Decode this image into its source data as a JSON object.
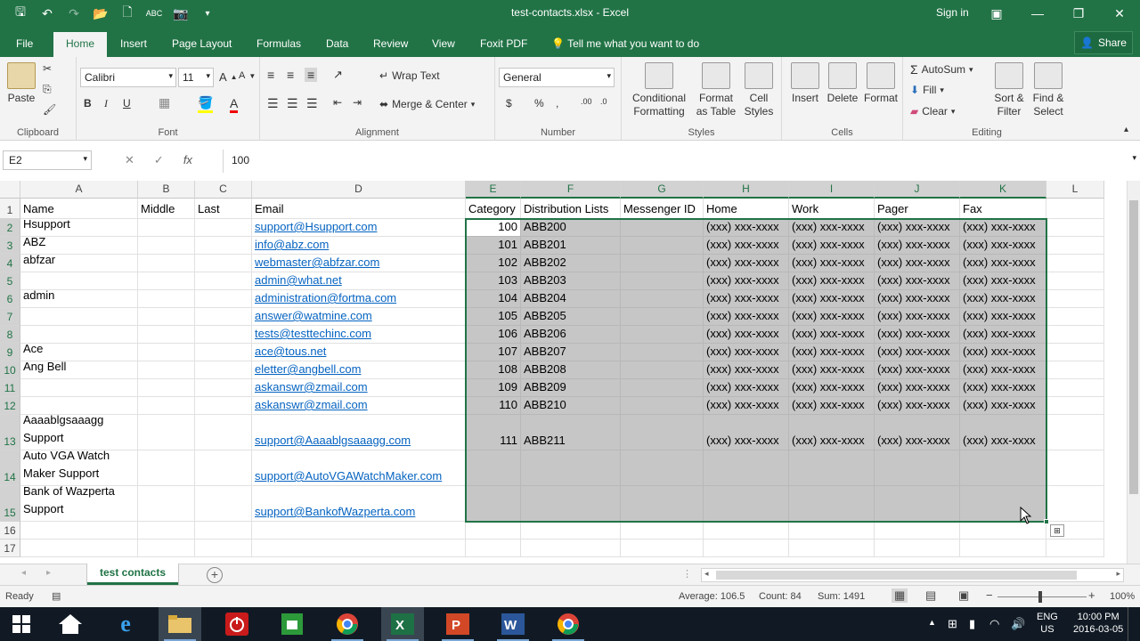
{
  "window": {
    "title": "test-contacts.xlsx - Excel",
    "sign_in": "Sign in"
  },
  "tabs": [
    "File",
    "Home",
    "Insert",
    "Page Layout",
    "Formulas",
    "Data",
    "Review",
    "View",
    "Foxit PDF"
  ],
  "tell_me": "Tell me what you want to do",
  "share": "Share",
  "ribbon": {
    "clipboard": {
      "paste": "Paste",
      "label": "Clipboard"
    },
    "font": {
      "name": "Calibri",
      "size": "11",
      "label": "Font"
    },
    "alignment": {
      "wrap_text": "Wrap Text",
      "merge_center": "Merge & Center",
      "label": "Alignment"
    },
    "number": {
      "format": "General",
      "label": "Number"
    },
    "styles": {
      "conditional": "Conditional Formatting",
      "format_table": "Format as Table",
      "cell_styles": "Cell Styles",
      "label": "Styles"
    },
    "cells": {
      "insert": "Insert",
      "delete": "Delete",
      "format": "Format",
      "label": "Cells"
    },
    "editing": {
      "autosum": "AutoSum",
      "fill": "Fill",
      "clear": "Clear",
      "sort": "Sort & Filter",
      "find": "Find & Select",
      "label": "Editing"
    }
  },
  "formula_bar": {
    "name_box": "E2",
    "fx": "fx",
    "value": "100"
  },
  "columns": [
    "A",
    "B",
    "C",
    "D",
    "E",
    "F",
    "G",
    "H",
    "I",
    "J",
    "K",
    "L"
  ],
  "rows": [
    "1",
    "2",
    "3",
    "4",
    "5",
    "6",
    "7",
    "8",
    "9",
    "10",
    "11",
    "12",
    "13",
    "14",
    "15",
    "16",
    "17"
  ],
  "headers": [
    "Name",
    "Middle",
    "Last",
    "Email",
    "Category",
    "Distribution Lists",
    "Messenger ID",
    "Home",
    "Work",
    "Pager",
    "Fax"
  ],
  "data_rows": [
    {
      "name": "Hsupport",
      "email": "support@Hsupport.com",
      "cat": "100",
      "dist": "ABB200",
      "phone": "(xxx) xxx-xxxx"
    },
    {
      "name": "ABZ",
      "email": "info@abz.com",
      "cat": "101",
      "dist": "ABB201",
      "phone": "(xxx) xxx-xxxx"
    },
    {
      "name": "abfzar",
      "email": "webmaster@abfzar.com",
      "cat": "102",
      "dist": "ABB202",
      "phone": "(xxx) xxx-xxxx"
    },
    {
      "name": "",
      "email": "admin@what.net",
      "cat": "103",
      "dist": "ABB203",
      "phone": "(xxx) xxx-xxxx"
    },
    {
      "name": "admin",
      "email": "administration@fortma.com",
      "cat": "104",
      "dist": "ABB204",
      "phone": "(xxx) xxx-xxxx"
    },
    {
      "name": "",
      "email": "answer@watmine.com",
      "cat": "105",
      "dist": "ABB205",
      "phone": "(xxx) xxx-xxxx"
    },
    {
      "name": "",
      "email": "tests@testtechinc.com",
      "cat": "106",
      "dist": "ABB206",
      "phone": "(xxx) xxx-xxxx"
    },
    {
      "name": "Ace",
      "email": "ace@tous.net",
      "cat": "107",
      "dist": "ABB207",
      "phone": "(xxx) xxx-xxxx"
    },
    {
      "name": "Ang Bell",
      "email": "eletter@angbell.com",
      "cat": "108",
      "dist": "ABB208",
      "phone": "(xxx) xxx-xxxx"
    },
    {
      "name": "",
      "email": "askanswr@zmail.com",
      "cat": "109",
      "dist": "ABB209",
      "phone": "(xxx) xxx-xxxx"
    },
    {
      "name": "",
      "email": "askanswr@zmail.com",
      "cat": "110",
      "dist": "ABB210",
      "phone": "(xxx) xxx-xxxx"
    },
    {
      "name": "Aaaablgsaaagg Support",
      "email": "support@Aaaablgsaaagg.com",
      "cat": "111",
      "dist": "ABB211",
      "phone": "(xxx) xxx-xxxx"
    },
    {
      "name": "Auto VGA Watch Maker Support",
      "email": "support@AutoVGAWatchMaker.com",
      "cat": "",
      "dist": "",
      "phone": ""
    },
    {
      "name": "Bank of Wazperta Support",
      "email": "support@BankofWazperta.com",
      "cat": "",
      "dist": "",
      "phone": ""
    }
  ],
  "sheet": {
    "tab": "test contacts",
    "add": "+"
  },
  "status": {
    "ready": "Ready",
    "average": "Average: 106.5",
    "count": "Count: 84",
    "sum": "Sum: 1491",
    "zoom": "100%"
  },
  "taskbar": {
    "lang": "ENG",
    "region": "US",
    "time": "10:00 PM",
    "date": "2016-03-05"
  },
  "colors": {
    "excel_green": "#217346",
    "selection_gray": "#c6c6c6",
    "link_blue": "#0563c1"
  }
}
